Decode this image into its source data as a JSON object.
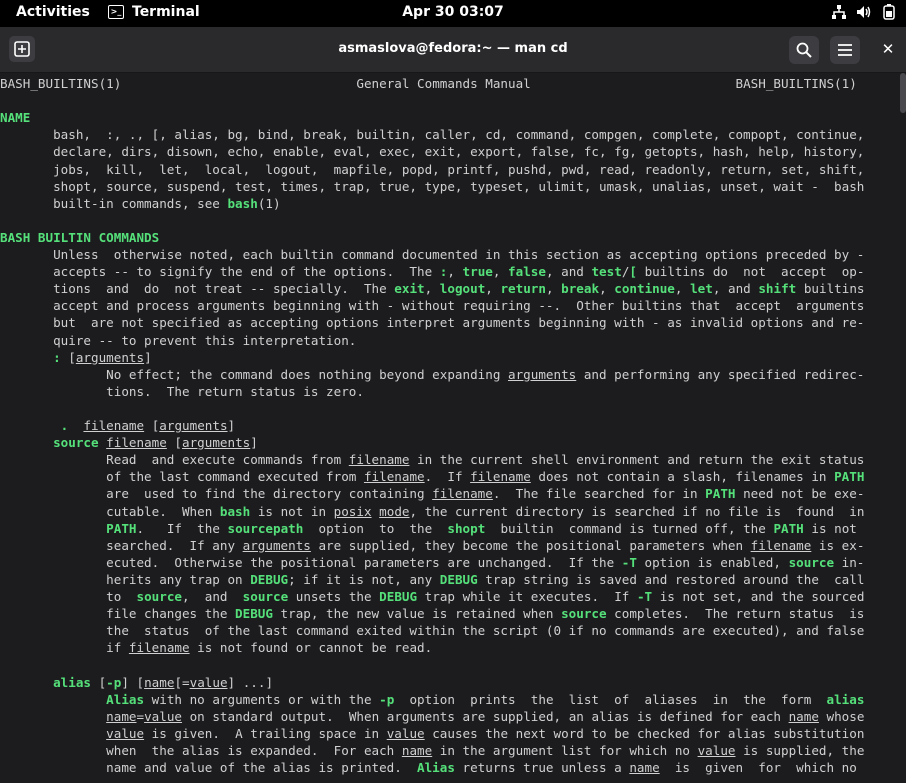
{
  "topbar": {
    "activities": "Activities",
    "app_name": "Terminal",
    "clock": "Apr 30  03:07"
  },
  "window": {
    "title": "asmaslova@fedora:~ — man cd"
  },
  "icons": {
    "new_tab": "new-tab-icon",
    "search": "search-icon",
    "menu": "hamburger-menu-icon",
    "close": "close-icon",
    "network": "network-icon",
    "volume": "volume-icon",
    "battery": "battery-icon",
    "terminal": "terminal-icon"
  },
  "colors": {
    "term_bg": "#1c1c1f",
    "term_fg": "#d0d0d0",
    "bold": "#55e07a",
    "titlebar": "#2a2a2d",
    "topbar": "#000000"
  },
  "man_lines": [
    [
      [
        "BASH_BUILTINS(1)",
        "t"
      ],
      [
        "                               ",
        "t"
      ],
      [
        "General Commands Manual",
        "t"
      ],
      [
        "                           ",
        "t"
      ],
      [
        "BASH_BUILTINS(1)",
        "t"
      ]
    ],
    [],
    [
      [
        "NAME",
        "h"
      ]
    ],
    [
      [
        "       bash,  :, ., [, alias, bg, bind, break, builtin, caller, cd, command, compgen, complete, compopt, continue,",
        "t"
      ]
    ],
    [
      [
        "       declare, dirs, disown, echo, enable, eval, exec, exit, export, false, fc, fg, getopts, hash, help, history,",
        "t"
      ]
    ],
    [
      [
        "       jobs,  kill,  let,  local,  logout,  mapfile, popd, printf, pushd, pwd, read, readonly, return, set, shift,",
        "t"
      ]
    ],
    [
      [
        "       shopt, source, suspend, test, times, trap, true, type, typeset, ulimit, umask, unalias, unset, wait -  bash",
        "t"
      ]
    ],
    [
      [
        "       built-in commands, see ",
        "t"
      ],
      [
        "bash",
        "b"
      ],
      [
        "(1)",
        "t"
      ]
    ],
    [],
    [
      [
        "BASH BUILTIN COMMANDS",
        "h"
      ]
    ],
    [
      [
        "       Unless  otherwise noted, each builtin command documented in this section as accepting options preceded by -",
        "t"
      ]
    ],
    [
      [
        "       accepts -- to signify the end of the options.  The ",
        "t"
      ],
      [
        ":",
        "b"
      ],
      [
        ", ",
        "t"
      ],
      [
        "true",
        "b"
      ],
      [
        ", ",
        "t"
      ],
      [
        "false",
        "b"
      ],
      [
        ", and ",
        "t"
      ],
      [
        "test",
        "b"
      ],
      [
        "/",
        "t"
      ],
      [
        "[",
        "b"
      ],
      [
        " builtins do  not  accept  op-",
        "t"
      ]
    ],
    [
      [
        "       tions  and  do  not treat -- specially.  The ",
        "t"
      ],
      [
        "exit",
        "b"
      ],
      [
        ", ",
        "t"
      ],
      [
        "logout",
        "b"
      ],
      [
        ", ",
        "t"
      ],
      [
        "return",
        "b"
      ],
      [
        ", ",
        "t"
      ],
      [
        "break",
        "b"
      ],
      [
        ", ",
        "t"
      ],
      [
        "continue",
        "b"
      ],
      [
        ", ",
        "t"
      ],
      [
        "let",
        "b"
      ],
      [
        ", and ",
        "t"
      ],
      [
        "shift",
        "b"
      ],
      [
        " builtins",
        "t"
      ]
    ],
    [
      [
        "       accept and process arguments beginning with - without requiring --.  Other builtins that  accept  arguments",
        "t"
      ]
    ],
    [
      [
        "       but  are not specified as accepting options interpret arguments beginning with - as invalid options and re-",
        "t"
      ]
    ],
    [
      [
        "       quire -- to prevent this interpretation.",
        "t"
      ]
    ],
    [
      [
        "       ",
        "t"
      ],
      [
        ":",
        "b"
      ],
      [
        " [",
        "t"
      ],
      [
        "arguments",
        "u"
      ],
      [
        "]",
        "t"
      ]
    ],
    [
      [
        "              No effect; the command does nothing beyond expanding ",
        "t"
      ],
      [
        "arguments",
        "u"
      ],
      [
        " and performing any specified redirec-",
        "t"
      ]
    ],
    [
      [
        "              tions.  The return status is zero.",
        "t"
      ]
    ],
    [],
    [
      [
        "        ",
        "t"
      ],
      [
        ".",
        "b"
      ],
      [
        "  ",
        "t"
      ],
      [
        "filename",
        "u"
      ],
      [
        " [",
        "t"
      ],
      [
        "arguments",
        "u"
      ],
      [
        "]",
        "t"
      ]
    ],
    [
      [
        "       ",
        "t"
      ],
      [
        "source",
        "b"
      ],
      [
        " ",
        "t"
      ],
      [
        "filename",
        "u"
      ],
      [
        " [",
        "t"
      ],
      [
        "arguments",
        "u"
      ],
      [
        "]",
        "t"
      ]
    ],
    [
      [
        "              Read  and execute commands from ",
        "t"
      ],
      [
        "filename",
        "u"
      ],
      [
        " in the current shell environment and return the exit status",
        "t"
      ]
    ],
    [
      [
        "              of the last command executed from ",
        "t"
      ],
      [
        "filename",
        "u"
      ],
      [
        ".  If ",
        "t"
      ],
      [
        "filename",
        "u"
      ],
      [
        " does not contain a slash, filenames in ",
        "t"
      ],
      [
        "PATH",
        "b"
      ]
    ],
    [
      [
        "              are  used to find the directory containing ",
        "t"
      ],
      [
        "filename",
        "u"
      ],
      [
        ".  The file searched for in ",
        "t"
      ],
      [
        "PATH",
        "b"
      ],
      [
        " need not be exe-",
        "t"
      ]
    ],
    [
      [
        "              cutable.  When ",
        "t"
      ],
      [
        "bash",
        "b"
      ],
      [
        " is not in ",
        "t"
      ],
      [
        "posix",
        "u"
      ],
      [
        " ",
        "t"
      ],
      [
        "mode",
        "u"
      ],
      [
        ", the current directory is searched if no file is  found  in",
        "t"
      ]
    ],
    [
      [
        "              ",
        "t"
      ],
      [
        "PATH",
        "b"
      ],
      [
        ".   If  the ",
        "t"
      ],
      [
        "sourcepath",
        "b"
      ],
      [
        "  option  to  the  ",
        "t"
      ],
      [
        "shopt",
        "b"
      ],
      [
        "  builtin  command is turned off, the ",
        "t"
      ],
      [
        "PATH",
        "b"
      ],
      [
        " is not",
        "t"
      ]
    ],
    [
      [
        "              searched.  If any ",
        "t"
      ],
      [
        "arguments",
        "u"
      ],
      [
        " are supplied, they become the positional parameters when ",
        "t"
      ],
      [
        "filename",
        "u"
      ],
      [
        " is ex-",
        "t"
      ]
    ],
    [
      [
        "              ecuted.  Otherwise the positional parameters are unchanged.  If the ",
        "t"
      ],
      [
        "-T",
        "b"
      ],
      [
        " option is enabled, ",
        "t"
      ],
      [
        "source",
        "b"
      ],
      [
        " in-",
        "t"
      ]
    ],
    [
      [
        "              herits any trap on ",
        "t"
      ],
      [
        "DEBUG",
        "b"
      ],
      [
        "; if it is not, any ",
        "t"
      ],
      [
        "DEBUG",
        "b"
      ],
      [
        " trap string is saved and restored around the  call",
        "t"
      ]
    ],
    [
      [
        "              to  ",
        "t"
      ],
      [
        "source",
        "b"
      ],
      [
        ",  and  ",
        "t"
      ],
      [
        "source",
        "b"
      ],
      [
        " unsets the ",
        "t"
      ],
      [
        "DEBUG",
        "b"
      ],
      [
        " trap while it executes.  If ",
        "t"
      ],
      [
        "-T",
        "b"
      ],
      [
        " is not set, and the sourced",
        "t"
      ]
    ],
    [
      [
        "              file changes the ",
        "t"
      ],
      [
        "DEBUG",
        "b"
      ],
      [
        " trap, the new value is retained when ",
        "t"
      ],
      [
        "source",
        "b"
      ],
      [
        " completes.  The return status  is",
        "t"
      ]
    ],
    [
      [
        "              the  status  of the last command exited within the script (0 if no commands are executed), and false",
        "t"
      ]
    ],
    [
      [
        "              if ",
        "t"
      ],
      [
        "filename",
        "u"
      ],
      [
        " is not found or cannot be read.",
        "t"
      ]
    ],
    [],
    [
      [
        "       ",
        "t"
      ],
      [
        "alias",
        "b"
      ],
      [
        " [",
        "t"
      ],
      [
        "-p",
        "b"
      ],
      [
        "] [",
        "t"
      ],
      [
        "name",
        "u"
      ],
      [
        "[=",
        "t"
      ],
      [
        "value",
        "u"
      ],
      [
        "] ...]",
        "t"
      ]
    ],
    [
      [
        "              ",
        "t"
      ],
      [
        "Alias",
        "b"
      ],
      [
        " with no arguments or with the ",
        "t"
      ],
      [
        "-p",
        "b"
      ],
      [
        "  option  prints  the  list  of  aliases  in  the  form  ",
        "t"
      ],
      [
        "alias",
        "b"
      ]
    ],
    [
      [
        "              ",
        "t"
      ],
      [
        "name",
        "u"
      ],
      [
        "=",
        "t"
      ],
      [
        "value",
        "u"
      ],
      [
        " on standard output.  When arguments are supplied, an alias is defined for each ",
        "t"
      ],
      [
        "name",
        "u"
      ],
      [
        " whose",
        "t"
      ]
    ],
    [
      [
        "              ",
        "t"
      ],
      [
        "value",
        "u"
      ],
      [
        " is given.  A trailing space in ",
        "t"
      ],
      [
        "value",
        "u"
      ],
      [
        " causes the next word to be checked for alias substitution",
        "t"
      ]
    ],
    [
      [
        "              when  the alias is expanded.  For each ",
        "t"
      ],
      [
        "name",
        "u"
      ],
      [
        " in the argument list for which no ",
        "t"
      ],
      [
        "value",
        "u"
      ],
      [
        " is supplied, the",
        "t"
      ]
    ],
    [
      [
        "              name and value of the alias is printed.  ",
        "t"
      ],
      [
        "Alias",
        "b"
      ],
      [
        " returns true unless a ",
        "t"
      ],
      [
        "name",
        "u"
      ],
      [
        "  is  given  for  which no",
        "t"
      ]
    ]
  ]
}
